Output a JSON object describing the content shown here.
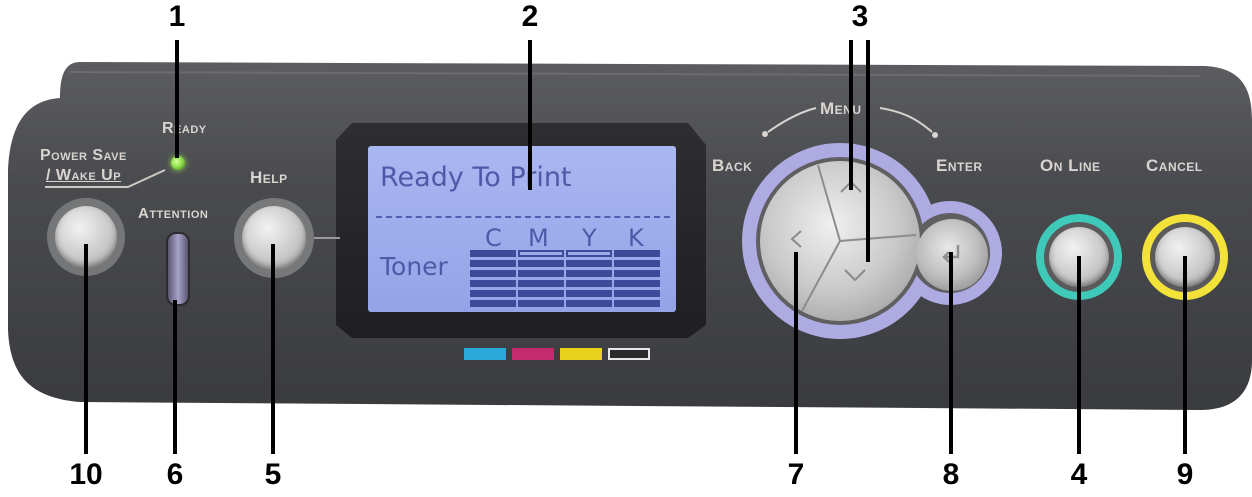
{
  "callouts": [
    "1",
    "2",
    "3",
    "4",
    "5",
    "6",
    "7",
    "8",
    "9",
    "10"
  ],
  "panel_labels": {
    "ready": "Ready",
    "power_save": "Power Save",
    "wake_up": "/ Wake Up",
    "attention": "Attention",
    "help": "Help",
    "menu": "Menu",
    "back": "Back",
    "enter": "Enter",
    "on_line": "On Line",
    "cancel": "Cancel"
  },
  "lcd": {
    "line1": "Ready To Print",
    "toner_label": "Toner",
    "toner_channels": [
      "C",
      "M",
      "Y",
      "K"
    ]
  },
  "colors": {
    "panel": "#48494c",
    "lcd": "#9aa9ea",
    "ready_led": "#8ee04a",
    "on_line_ring": "#3ec9b8",
    "cancel_ring": "#f2e23a",
    "nav_ring": "#aeabe2",
    "swatch_cyan": "#2aa8d8",
    "swatch_magenta": "#c42a6e",
    "swatch_yellow": "#e8d21e",
    "swatch_black": "#2b2b2b"
  },
  "icons": [
    "led-icon",
    "left-arrow-icon",
    "up-arrow-icon",
    "down-arrow-icon",
    "enter-arrow-icon"
  ]
}
